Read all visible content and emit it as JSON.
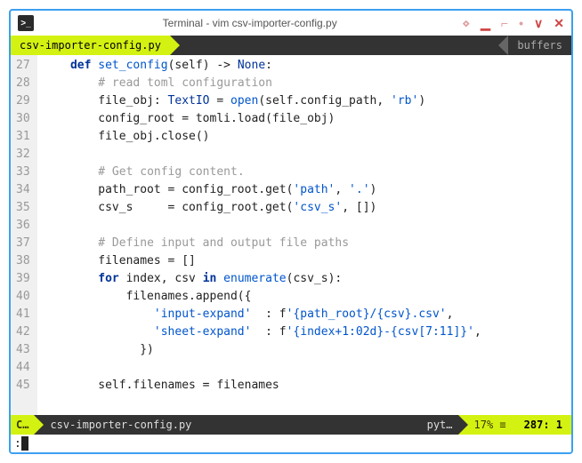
{
  "window": {
    "title": "Terminal - vim csv-importer-config.py"
  },
  "tabbar": {
    "active_tab": "csv-importer-config.py",
    "buffers_label": "buffers"
  },
  "gutter": {
    "start": 27,
    "end": 45
  },
  "code": {
    "lines": [
      {
        "indent": 4,
        "tokens": [
          {
            "t": "def ",
            "c": "kw"
          },
          {
            "t": "set_config",
            "c": "fn"
          },
          {
            "t": "(self) -> "
          },
          {
            "t": "None",
            "c": "type"
          },
          {
            "t": ":"
          }
        ]
      },
      {
        "indent": 8,
        "tokens": [
          {
            "t": "# read toml configuration",
            "c": "cmt"
          }
        ]
      },
      {
        "indent": 8,
        "tokens": [
          {
            "t": "file_obj: "
          },
          {
            "t": "TextIO",
            "c": "type"
          },
          {
            "t": " = "
          },
          {
            "t": "open",
            "c": "fn"
          },
          {
            "t": "(self.config_path, "
          },
          {
            "t": "'rb'",
            "c": "str"
          },
          {
            "t": ")"
          }
        ]
      },
      {
        "indent": 8,
        "tokens": [
          {
            "t": "config_root = tomli.load(file_obj)"
          }
        ]
      },
      {
        "indent": 8,
        "tokens": [
          {
            "t": "file_obj.close()"
          }
        ]
      },
      {
        "indent": 0,
        "tokens": []
      },
      {
        "indent": 8,
        "tokens": [
          {
            "t": "# Get config content.",
            "c": "cmt"
          }
        ]
      },
      {
        "indent": 8,
        "tokens": [
          {
            "t": "path_root = config_root.get("
          },
          {
            "t": "'path'",
            "c": "str"
          },
          {
            "t": ", "
          },
          {
            "t": "'.'",
            "c": "str"
          },
          {
            "t": ")"
          }
        ]
      },
      {
        "indent": 8,
        "tokens": [
          {
            "t": "csv_s     = config_root.get("
          },
          {
            "t": "'csv_s'",
            "c": "str"
          },
          {
            "t": ", [])"
          }
        ]
      },
      {
        "indent": 0,
        "tokens": []
      },
      {
        "indent": 8,
        "tokens": [
          {
            "t": "# Define input and output file paths",
            "c": "cmt"
          }
        ]
      },
      {
        "indent": 8,
        "tokens": [
          {
            "t": "filenames = []"
          }
        ]
      },
      {
        "indent": 8,
        "tokens": [
          {
            "t": "for ",
            "c": "kw"
          },
          {
            "t": "index, csv "
          },
          {
            "t": "in ",
            "c": "kw"
          },
          {
            "t": "enumerate",
            "c": "fn"
          },
          {
            "t": "(csv_s):"
          }
        ]
      },
      {
        "indent": 12,
        "tokens": [
          {
            "t": "filenames.append({"
          }
        ]
      },
      {
        "indent": 16,
        "tokens": [
          {
            "t": "'input-expand'",
            "c": "str"
          },
          {
            "t": "  : f"
          },
          {
            "t": "'{path_root}/{csv}.csv'",
            "c": "str"
          },
          {
            "t": ","
          }
        ]
      },
      {
        "indent": 16,
        "tokens": [
          {
            "t": "'sheet-expand'",
            "c": "str"
          },
          {
            "t": "  : f"
          },
          {
            "t": "'{index+1:02d}-{csv[7:11]}'",
            "c": "str"
          },
          {
            "t": ","
          }
        ]
      },
      {
        "indent": 14,
        "tokens": [
          {
            "t": "})"
          }
        ]
      },
      {
        "indent": 0,
        "tokens": []
      },
      {
        "indent": 8,
        "tokens": [
          {
            "t": "self.filenames = filenames"
          }
        ]
      }
    ]
  },
  "statusbar": {
    "mode": "C…",
    "filename": "csv-importer-config.py",
    "filetype": "pyt…",
    "percent": "17% ≡",
    "position": "287: 1"
  },
  "cmdline": {
    "prompt": ":"
  }
}
